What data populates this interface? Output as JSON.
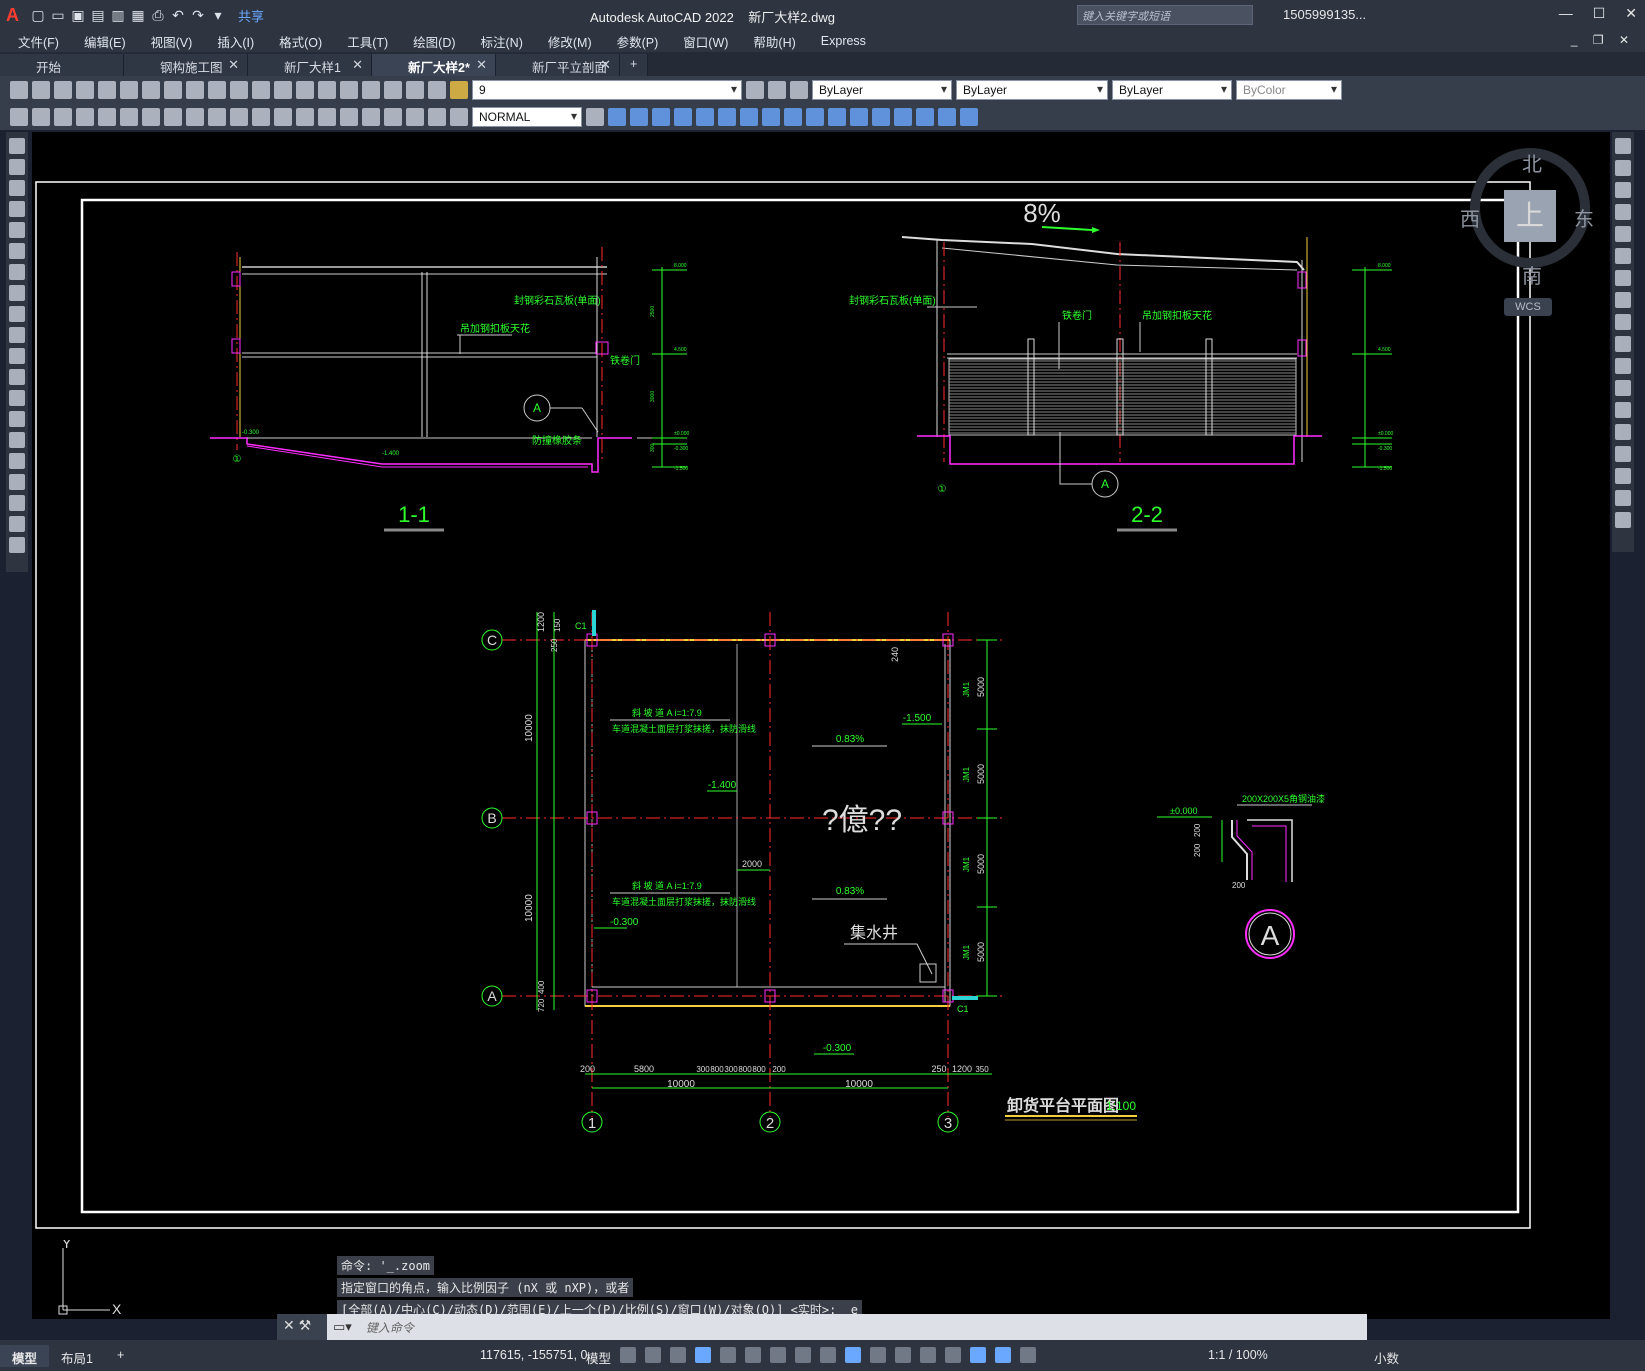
{
  "app": {
    "title": "Autodesk AutoCAD 2022",
    "file": "新厂大样2.dwg",
    "share": "共享",
    "search_placeholder": "键入关键字或短语",
    "user": "1505999135..."
  },
  "menu": [
    "文件(F)",
    "编辑(E)",
    "视图(V)",
    "插入(I)",
    "格式(O)",
    "工具(T)",
    "绘图(D)",
    "标注(N)",
    "修改(M)",
    "参数(P)",
    "窗口(W)",
    "帮助(H)",
    "Express"
  ],
  "tabs": [
    {
      "label": "开始",
      "closable": false
    },
    {
      "label": "钢构施工图",
      "closable": true
    },
    {
      "label": "新厂大样1",
      "closable": true
    },
    {
      "label": "新厂大样2*",
      "closable": true,
      "active": true
    },
    {
      "label": "新厂平立剖面图*",
      "closable": true
    }
  ],
  "toolbar": {
    "layer": "9",
    "color": "ByLayer",
    "linetype": "ByLayer",
    "lineweight": "ByLayer",
    "plotstyle": "ByColor",
    "dimstyle": "NORMAL"
  },
  "viewcube": {
    "north": "北",
    "south": "南",
    "west": "西",
    "east": "东",
    "top": "上",
    "wcs": "WCS"
  },
  "drawing": {
    "sec1": {
      "title": "1-1",
      "labels": [
        "封钢彩石瓦板(单面)",
        "吊加钢扣板天花",
        "铁卷门",
        "防撞橡胶条"
      ],
      "marker": "A",
      "axis": "①",
      "levels": [
        "8.000",
        "4.500",
        "±0.000",
        "-0.300",
        "-1.500"
      ],
      "dims": [
        "2500",
        "3000",
        "300",
        "1200"
      ],
      "slope": "-1.400",
      "mark0": "-0.300"
    },
    "sec2": {
      "title": "2-2",
      "slope": "8%",
      "labels": [
        "封钢彩石瓦板(单面)",
        "铁卷门",
        "吊加钢扣板天花"
      ],
      "marker": "A",
      "axis": "①",
      "levels": [
        "8.000",
        "4.500",
        "±0.000",
        "-0.300",
        "-1.500"
      ]
    },
    "plan": {
      "title": "卸货平台平面图",
      "scale": "1:100",
      "rows": [
        "C",
        "B",
        "A"
      ],
      "cols": [
        "1",
        "2",
        "3"
      ],
      "ramp_title": "斜 坡 道 A  i=1:7.9",
      "ramp_note": "车道混凝土面层打浆抹搓，抹防滑线",
      "slope": "0.83%",
      "center": "?億??",
      "pit": "集水井",
      "levels": [
        "-1.400",
        "-1.500",
        "-0.300",
        "-0.300"
      ],
      "left_dims": [
        "1200",
        "250",
        "150",
        "10000",
        "10000",
        "720",
        "400"
      ],
      "right_dims": [
        "5000",
        "5000",
        "5000",
        "5000"
      ],
      "right_labels": [
        "JM1",
        "JM1",
        "JM1",
        "JM1"
      ],
      "top_labels": [
        "C1",
        "C1"
      ],
      "dim240": "240",
      "dim2000": "2000",
      "bottom_dims": [
        "200",
        "5800",
        "300",
        "800",
        "300",
        "800",
        "800",
        "200",
        "250",
        "1200",
        "350"
      ],
      "bottom_totals": [
        "10000",
        "10000"
      ]
    },
    "detail": {
      "marker": "A",
      "level": "±0.000",
      "dims": [
        "200",
        "200",
        "200"
      ],
      "spec": "200X200X5角钢油漆"
    }
  },
  "commands": [
    "命令: '_.zoom",
    "指定窗口的角点，输入比例因子 (nX 或 nXP)，或者",
    "[全部(A)/中心(C)/动态(D)/范围(E)/上一个(P)/比例(S)/窗口(W)/对象(O)] <实时>: _e"
  ],
  "cmd_placeholder": "键入命令",
  "status": {
    "model_tab": "模型",
    "layout_tab": "布局1",
    "coords": "117615, -155751, 0",
    "mode": "模型",
    "scale": "1:1 / 100%",
    "units": "小数"
  }
}
